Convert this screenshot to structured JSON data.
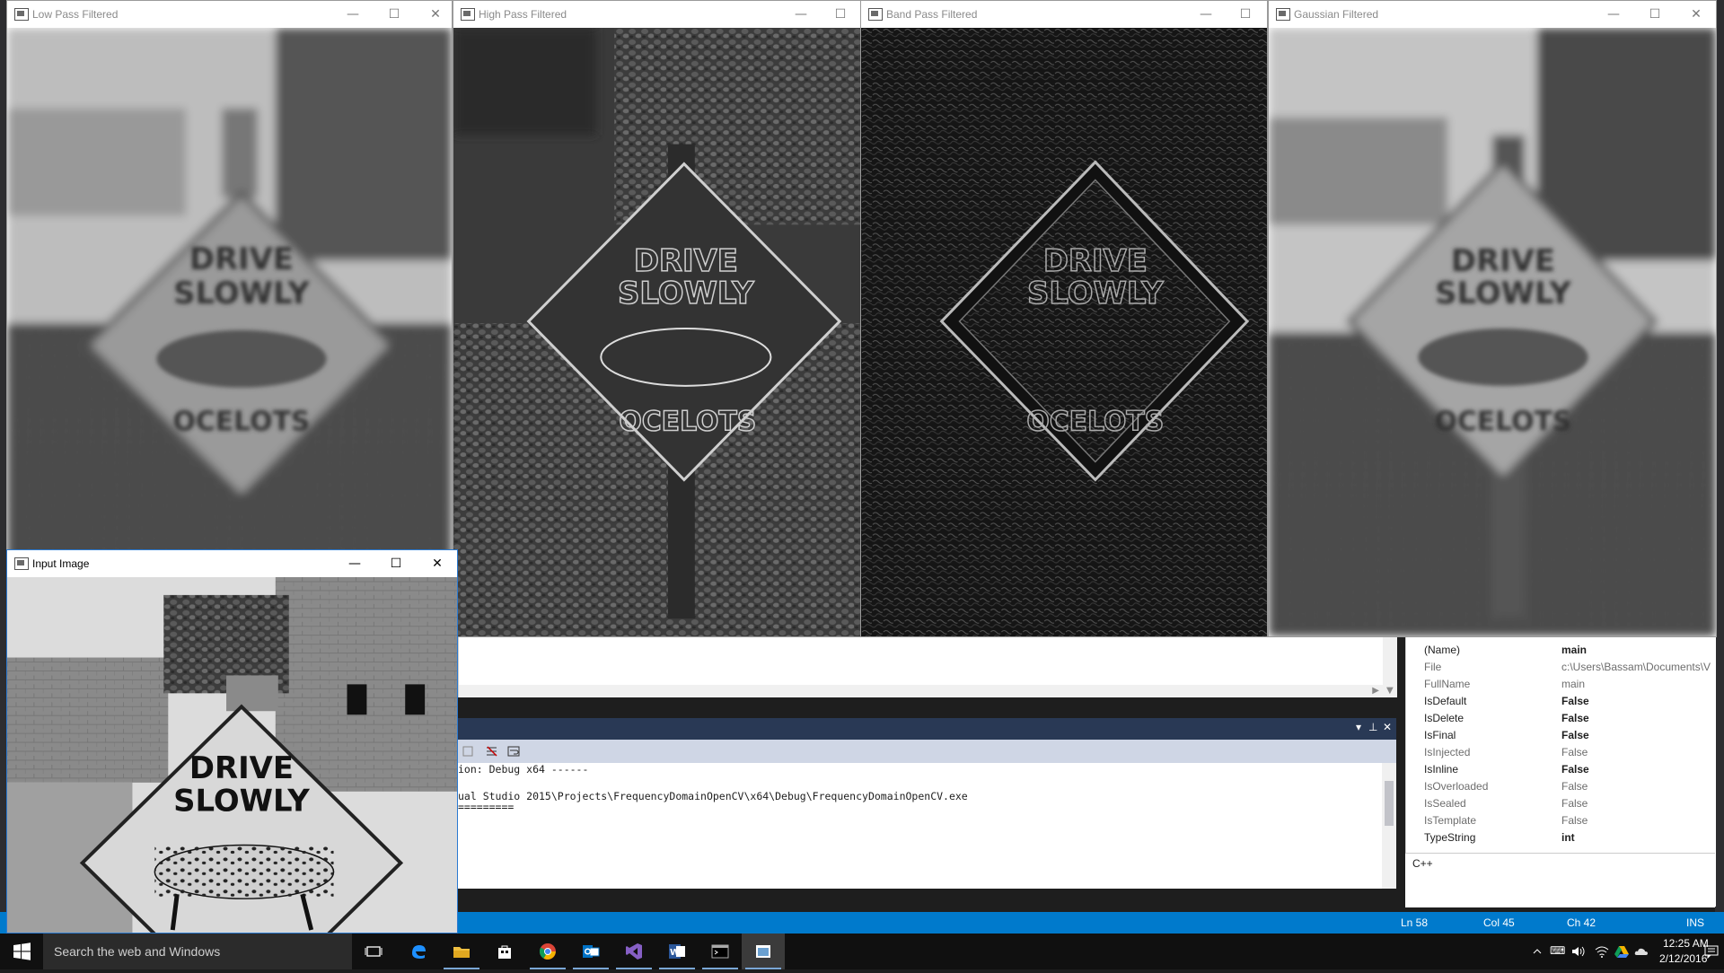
{
  "windows": {
    "low_pass": {
      "title": "Low Pass Filtered"
    },
    "high_pass": {
      "title": "High Pass Filtered"
    },
    "band_pass": {
      "title": "Band Pass Filtered"
    },
    "gaussian": {
      "title": "Gaussian Filtered"
    },
    "input": {
      "title": "Input Image"
    }
  },
  "sign": {
    "line1": "DRIVE",
    "line2": "SLOWLY",
    "line3": "OCELOTS"
  },
  "window_controls": {
    "minimize": "—",
    "maximize": "☐",
    "close": "✕"
  },
  "output": {
    "lines": [
      "ion: Debug x64 ------",
      "",
      "ual Studio 2015\\Projects\\FrequencyDomainOpenCV\\x64\\Debug\\FrequencyDomainOpenCV.exe",
      "========="
    ]
  },
  "properties": {
    "category": "C++",
    "rows": [
      {
        "name": "(Name)",
        "value": "main",
        "style": "bold"
      },
      {
        "name": "File",
        "value": "c:\\Users\\Bassam\\Documents\\V",
        "style": "grey"
      },
      {
        "name": "FullName",
        "value": "main",
        "style": "grey"
      },
      {
        "name": "IsDefault",
        "value": "False",
        "style": "bold"
      },
      {
        "name": "IsDelete",
        "value": "False",
        "style": "bold"
      },
      {
        "name": "IsFinal",
        "value": "False",
        "style": "bold"
      },
      {
        "name": "IsInjected",
        "value": "False",
        "style": "grey"
      },
      {
        "name": "IsInline",
        "value": "False",
        "style": "bold"
      },
      {
        "name": "IsOverloaded",
        "value": "False",
        "style": "grey"
      },
      {
        "name": "IsSealed",
        "value": "False",
        "style": "grey"
      },
      {
        "name": "IsTemplate",
        "value": "False",
        "style": "grey"
      },
      {
        "name": "TypeString",
        "value": "int",
        "style": "bold"
      }
    ],
    "description": "C++"
  },
  "statusbar": {
    "ln": "Ln 58",
    "col": "Col 45",
    "ch": "Ch 42",
    "mode": "INS"
  },
  "taskbar": {
    "search_placeholder": "Search the web and Windows",
    "time": "12:25 AM",
    "date": "2/12/2016",
    "apps": [
      "task-view",
      "edge",
      "file-explorer",
      "store",
      "chrome",
      "outlook",
      "visual-studio",
      "word",
      "command-prompt",
      "opencv-window"
    ]
  },
  "colors": {
    "vs_blue": "#007acc",
    "taskbar": "#101010",
    "output_title": "#293955"
  }
}
